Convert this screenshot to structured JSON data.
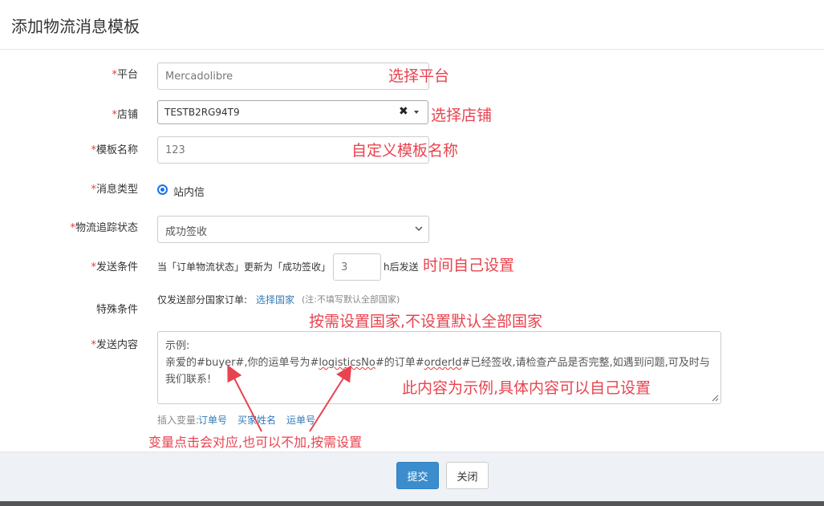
{
  "modal": {
    "title": "添加物流消息模板"
  },
  "form": {
    "platform": {
      "label": "平台",
      "required_mark": "*",
      "value": "Mercadolibre"
    },
    "shop": {
      "label": "店铺",
      "required_mark": "*",
      "value": "TESTB2RG94T9",
      "clear_glyph": "✖"
    },
    "template_name": {
      "label": "模板名称",
      "required_mark": "*",
      "value": "123"
    },
    "message_type": {
      "label": "消息类型",
      "required_mark": "*",
      "option": "站内信"
    },
    "tracking_status": {
      "label": "物流追踪状态",
      "required_mark": "*",
      "value": "成功签收"
    },
    "send_condition": {
      "label": "发送条件",
      "required_mark": "*",
      "prefix": "当「订单物流状态」更新为「成功签收」",
      "hours": "3",
      "suffix": "h后发送"
    },
    "special_condition": {
      "label": "特殊条件",
      "text": "仅发送部分国家订单:",
      "link": "选择国家",
      "note": "(注:不填写默认全部国家)"
    },
    "content": {
      "label": "发送内容",
      "required_mark": "*",
      "line1": "示例:",
      "body_a": "亲爱的#buyer#,你的运单号为#",
      "body_b": "logisticsNo",
      "body_c": "#的订单#",
      "body_d": "orderId",
      "body_e": "#已经签收,请检查产品是否完整,如遇到问题,可及时与我们联系!"
    },
    "variables": {
      "prefix": "插入变量:",
      "items": [
        "订单号",
        "买家姓名",
        "运单号"
      ]
    }
  },
  "annotations": {
    "platform": "选择平台",
    "shop": "选择店铺",
    "template_name": "自定义模板名称",
    "time": "时间自己设置",
    "country": "按需设置国家,不设置默认全部国家",
    "content": "此内容为示例,具体内容可以自己设置",
    "variables": "变量点击会对应,也可以不加,按需设置"
  },
  "footer": {
    "submit": "提交",
    "close": "关闭"
  },
  "colors": {
    "annotation": "#e8434f",
    "primary": "#3c8dcd",
    "link": "#337ab7"
  }
}
